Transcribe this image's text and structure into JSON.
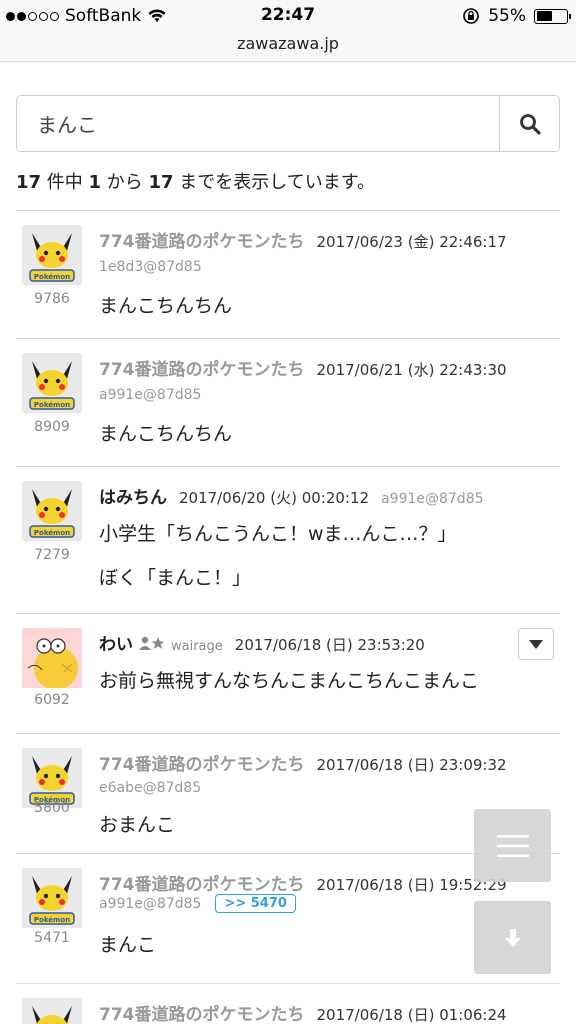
{
  "status": {
    "carrier": "SoftBank",
    "time": "22:47",
    "battery": "55%",
    "battery_level": 0.55
  },
  "browser": {
    "url": "zawazawa.jp"
  },
  "search": {
    "value": "まんこ",
    "placeholder": ""
  },
  "results": {
    "total": "17",
    "from": "1",
    "to": "17",
    "t1": " 件中 ",
    "t2": " から ",
    "t3": " までを表示しています。"
  },
  "posts": [
    {
      "id": "9786",
      "name": "774番道路のポケモンたち",
      "date": "2017/06/23 (金) 22:46:17",
      "hash": "1e8d3@87d85",
      "body": "まんこちんちん"
    },
    {
      "id": "8909",
      "name": "774番道路のポケモンたち",
      "date": "2017/06/21 (水) 22:43:30",
      "hash": "a991e@87d85",
      "body": "まんこちんちん"
    },
    {
      "id": "7279",
      "name": "はみちん",
      "date": "2017/06/20 (火) 00:20:12",
      "hash": "a991e@87d85",
      "body1": "小学生「ちんこうんこ！wま…んこ…？」",
      "body2": "ぼく「まんこ！」"
    },
    {
      "id": "6092",
      "name": "わい",
      "user": "wairage",
      "date": "2017/06/18 (日) 23:53:20",
      "body": "お前ら無視すんなちんこまんこちんこまんこ"
    },
    {
      "id": "5800",
      "name": "774番道路のポケモンたち",
      "date": "2017/06/18 (日) 23:09:32",
      "hash": "e6abe@87d85",
      "body": "おまんこ"
    },
    {
      "id": "5471",
      "name": "774番道路のポケモンたち",
      "date": "2017/06/18 (日) 19:52:29",
      "hash": "a991e@87d85",
      "reply": ">> 5470",
      "body": "まんこ"
    },
    {
      "name": "774番道路のポケモンたち",
      "date": "2017/06/18 (日) 01:06:24"
    }
  ]
}
